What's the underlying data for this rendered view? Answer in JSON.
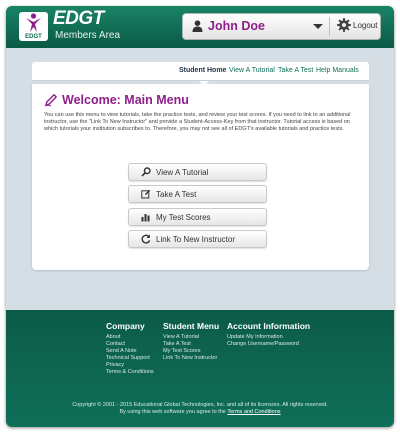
{
  "header": {
    "logo_small_text": "EDGT",
    "brand": "EDGT",
    "brand_sub": "Members Area",
    "user_name": "John Doe",
    "logout_label": "Logout"
  },
  "nav": {
    "items": [
      {
        "label": "Student Home",
        "active": true
      },
      {
        "label": "View A Tutorial",
        "active": false
      },
      {
        "label": "Take A Test",
        "active": false
      },
      {
        "label": "Help Manuals",
        "active": false
      }
    ]
  },
  "main": {
    "title": "Welcome: Main Menu",
    "intro": "You can use this menu to view tutorials, take the practice tests, and review your test scores. If you need to link to an additional instructor, use the \"Link To New Instructor\" and provide a Student-Access-Key from that instructor. Tutorial access is based on which tutorials your institution subscribes to. Therefore, you may not see all of EDGT's available tutorials and practice tests.",
    "buttons": [
      {
        "label": "View A Tutorial",
        "icon": "search-icon"
      },
      {
        "label": "Take A Test",
        "icon": "edit-icon"
      },
      {
        "label": "My Test Scores",
        "icon": "bar-chart-icon"
      },
      {
        "label": "Link To New Instructor",
        "icon": "refresh-icon"
      }
    ]
  },
  "footer": {
    "company": {
      "title": "Company",
      "links": [
        "About",
        "Contact",
        "Send A Note",
        "Technical Support",
        "Privacy",
        "Terms & Conditions"
      ]
    },
    "student_menu": {
      "title": "Student Menu",
      "links": [
        "View A Tutorial",
        "Take A Test",
        "My Test Scores",
        "Link To New Instructor"
      ]
    },
    "account": {
      "title": "Account Information",
      "links": [
        "Update My Information",
        "Change Username/Password"
      ]
    },
    "copyright": "Copyright © 2001 - 2015 Educational Global Technologies, Inc. and all of its licensors. All rights reserved.",
    "terms_prefix": "By using this web software you agree to the",
    "terms_link": "Terms and Conditions"
  },
  "colors": {
    "brand_green": "#0f6f57",
    "accent_purple": "#8e1f8a",
    "panel_bg": "#d5dde5"
  }
}
